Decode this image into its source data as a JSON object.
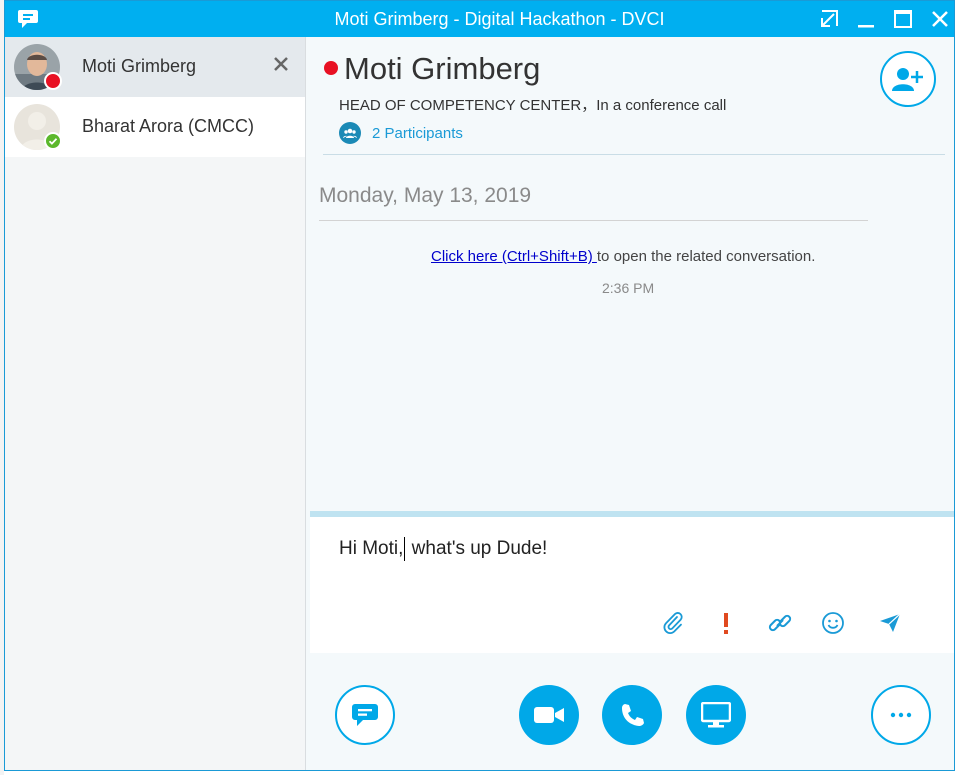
{
  "window": {
    "title": "Moti Grimberg - Digital Hackathon - DVCI"
  },
  "icons": {
    "app": "chat-bubble-icon",
    "popout": "popout-icon",
    "minimize": "minimize-icon",
    "maximize": "maximize-icon",
    "close": "close-icon"
  },
  "sidebar": {
    "items": [
      {
        "name": "Moti Grimberg",
        "presence": "busy",
        "presence_color": "#e81123",
        "active": true
      },
      {
        "name": "Bharat Arora (CMCC)",
        "presence": "available",
        "presence_color": "#5cb82c",
        "active": false
      }
    ]
  },
  "header": {
    "name": "Moti Grimberg",
    "status_color": "#e81123",
    "subtitle": "HEAD OF COMPETENCY CENTER，In a conference call",
    "participants_label": "2 Participants"
  },
  "conversation": {
    "date": "Monday, May 13, 2019",
    "message": {
      "link_text": "Click here (Ctrl+Shift+B) ",
      "rest_text": " to open the related conversation.",
      "time": "2:36 PM"
    }
  },
  "compose": {
    "text_before_caret": "Hi Moti,",
    "text_after_caret": " what's up Dude!"
  },
  "colors": {
    "accent": "#00a8e8",
    "titlebar": "#00aff0",
    "busy": "#e81123",
    "available": "#5cb82c",
    "important": "#e04a1f"
  }
}
